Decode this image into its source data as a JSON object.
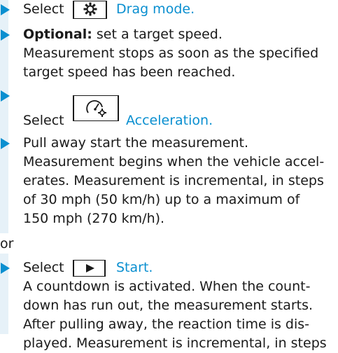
{
  "steps": [
    {
      "select_label": "Select",
      "link_label": "Drag mode.",
      "icon": "gear-icon"
    },
    {
      "bold_label": "Optional:",
      "text": " set a target speed.",
      "lines": [
        "Measurement stops as soon as the specified",
        "target speed has been reached."
      ]
    },
    {
      "select_label": "Select",
      "link_label": "Acceleration.",
      "icon": "speedometer-gear-icon"
    },
    {
      "lines": [
        "Pull away start the measurement.",
        "Measurement begins when the vehicle accel-",
        "erates. Measurement is incremental, in steps",
        "of 30 mph (50 km/h) up to a maximum of",
        "150 mph (270 km/h)."
      ]
    },
    {
      "select_label": "Select",
      "link_label": "Start.",
      "icon": "play-icon",
      "lines": [
        "A countdown is activated. When the count-",
        "down has run out, the measurement starts.",
        "After pulling away, the reaction time is dis-",
        "played. Measurement is incremental, in steps"
      ]
    }
  ],
  "or_label": "or",
  "colors": {
    "accent": "#0a8fd0",
    "text": "#1a1a1a",
    "sidebar": "#e6f1f8"
  }
}
